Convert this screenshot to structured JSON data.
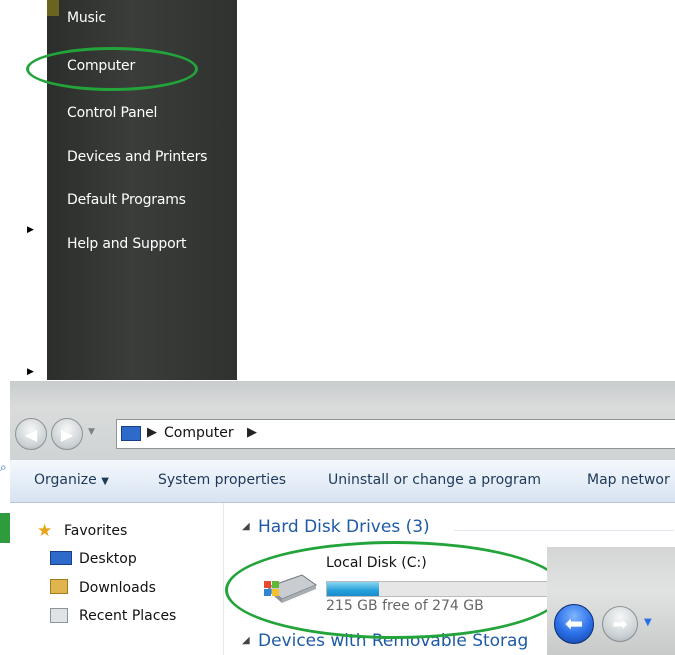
{
  "start_menu": {
    "items": [
      "Music",
      "Computer",
      "Control Panel",
      "Devices and Printers",
      "Default Programs",
      "Help and Support"
    ]
  },
  "explorer": {
    "breadcrumb": {
      "location": "Computer"
    },
    "toolbar": {
      "organize": "Organize",
      "system_properties": "System properties",
      "uninstall": "Uninstall or change a program",
      "map_network": "Map networ"
    },
    "favorites": {
      "header": "Favorites",
      "items": [
        "Desktop",
        "Downloads",
        "Recent Places"
      ]
    },
    "content": {
      "group1": "Hard Disk Drives (3)",
      "disk": {
        "name": "Local Disk (C:)",
        "free_text": "215 GB free of 274 GB",
        "used_fraction": 0.215
      },
      "group2": "Devices with Removable Storag"
    }
  },
  "colors": {
    "highlight_oval": "#22a43a",
    "link_blue": "#1e5aa6"
  },
  "icons": [
    "computer-icon",
    "back-arrow-icon",
    "forward-arrow-icon",
    "star-icon",
    "desktop-icon",
    "downloads-icon",
    "recent-places-icon",
    "hard-disk-icon"
  ]
}
